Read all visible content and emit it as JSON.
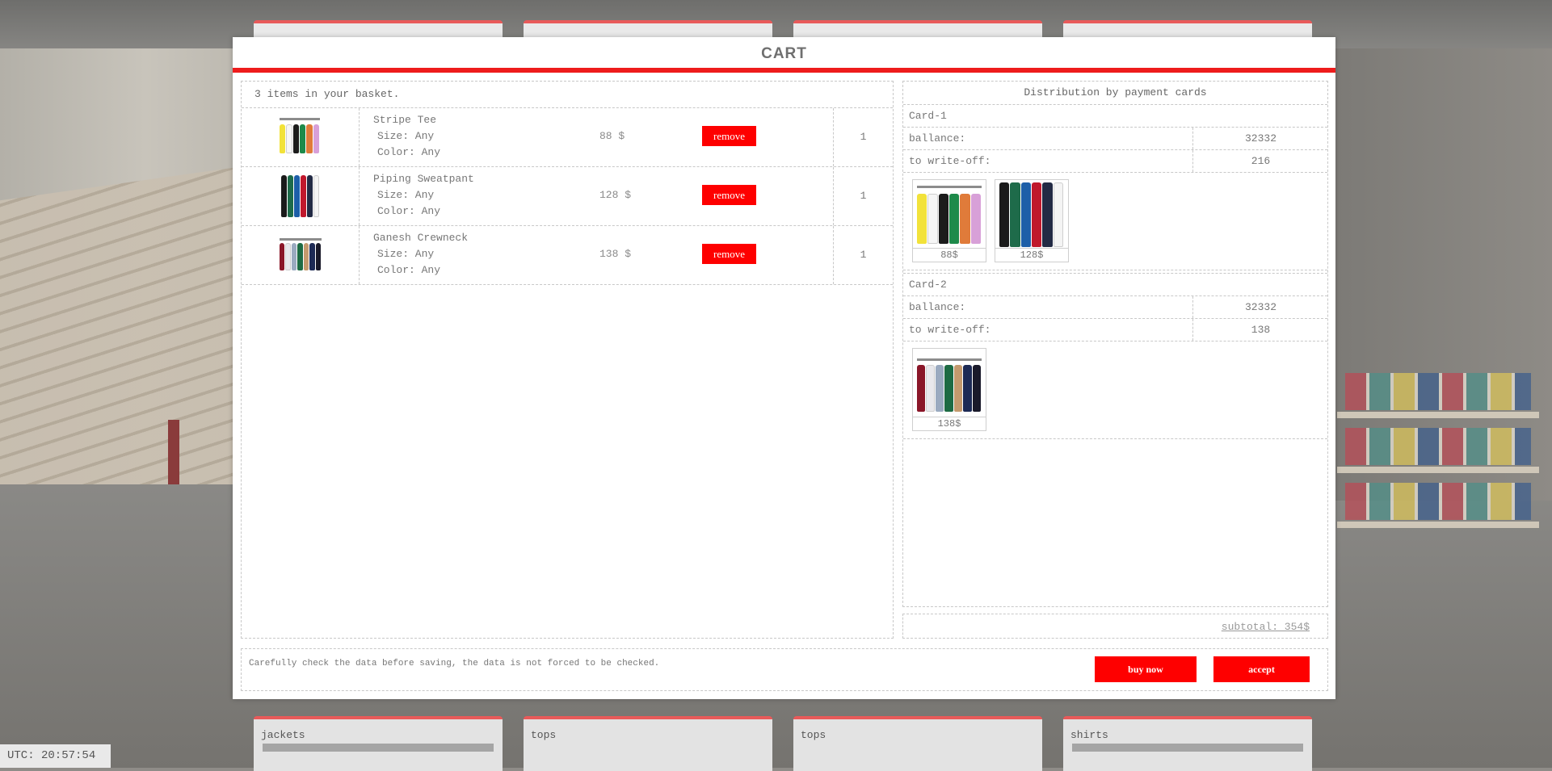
{
  "modal": {
    "title": "CART"
  },
  "basket": {
    "count_text": "3 items in your basket.",
    "items": [
      {
        "name": "Stripe Tee",
        "size": "Size: Any",
        "color": "Color: Any",
        "price": "88 $",
        "remove_label": "remove",
        "quantity": "1"
      },
      {
        "name": "Piping Sweatpant",
        "size": "Size: Any",
        "color": "Color: Any",
        "price": "128 $",
        "remove_label": "remove",
        "quantity": "1"
      },
      {
        "name": "Ganesh Crewneck",
        "size": "Size: Any",
        "color": "Color: Any",
        "price": "138 $",
        "remove_label": "remove",
        "quantity": "1"
      }
    ]
  },
  "distribution": {
    "title": "Distribution by payment cards",
    "cards": [
      {
        "name": "Card-1",
        "balance_label": "ballance:",
        "balance": "32332",
        "writeoff_label": "to write-off:",
        "writeoff": "216",
        "items": [
          {
            "price": "88$"
          },
          {
            "price": "128$"
          }
        ]
      },
      {
        "name": "Card-2",
        "balance_label": "ballance:",
        "balance": "32332",
        "writeoff_label": "to write-off:",
        "writeoff": "138",
        "items": [
          {
            "price": "138$"
          }
        ]
      }
    ]
  },
  "subtotal": "subtotal: 354$",
  "footer": {
    "note": "Carefully check the data before saving, the data is not forced to be checked.",
    "buy_now_label": "buy now",
    "accept_label": "accept"
  },
  "categories_bottom": [
    "jackets",
    "tops",
    "tops",
    "shirts"
  ],
  "utc_time": "UTC: 20:57:54",
  "colors": {
    "accent": "#fe0000",
    "header_line": "#ee1c1c"
  },
  "palettes": {
    "tee": [
      "#f2e23a",
      "#f6f6f6",
      "#1c1c1c",
      "#1e8a4a",
      "#e07b3a",
      "#d8a0d8"
    ],
    "sweatpant": [
      "#1a1a1a",
      "#1e6b4a",
      "#1d5fa8",
      "#c0182c",
      "#222a44",
      "#f4f4f4"
    ],
    "crewneck": [
      "#8a1628",
      "#e8e8ec",
      "#9aaac0",
      "#1d6b44",
      "#c49a6e",
      "#1d2a55",
      "#1a1a2a"
    ]
  }
}
